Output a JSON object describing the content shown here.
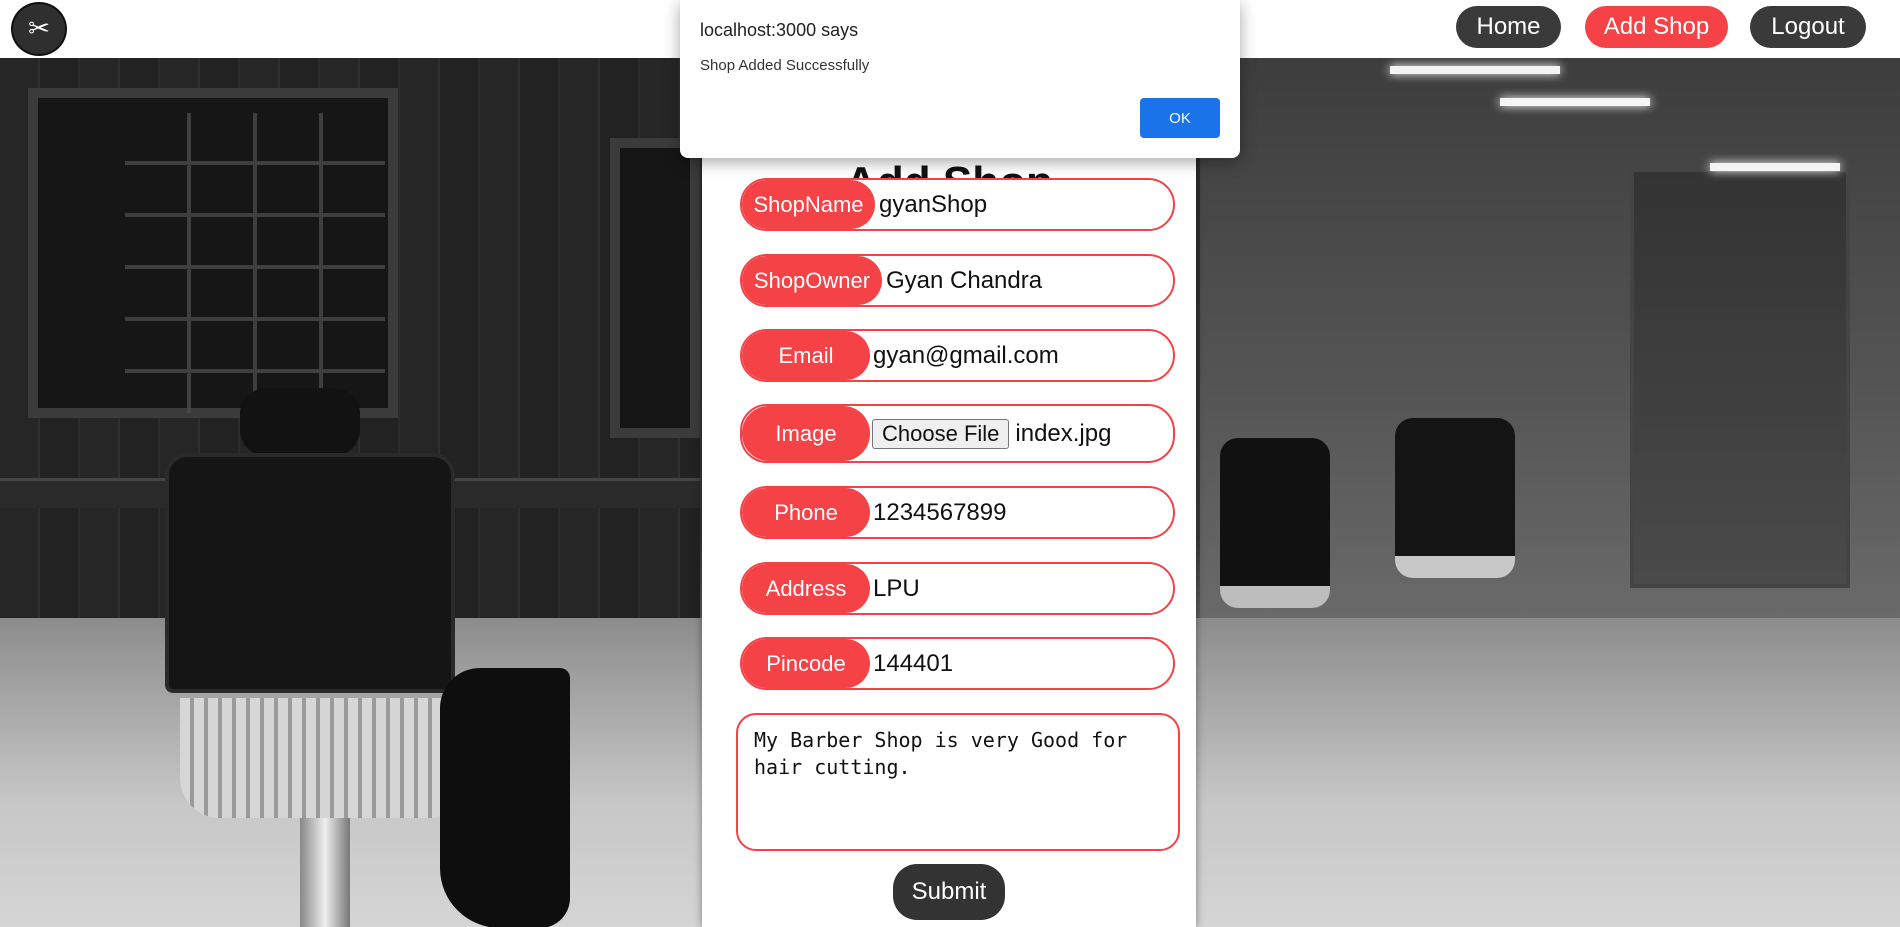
{
  "dialog": {
    "title": "localhost:3000 says",
    "message": "Shop Added Successfully",
    "ok_label": "OK"
  },
  "nav": {
    "logo_icon": "scissors-icon",
    "home_label": "Home",
    "add_shop_label": "Add Shop",
    "logout_label": "Logout"
  },
  "form": {
    "title": "Add Shop",
    "fields": [
      {
        "label": "ShopName",
        "value": "gyanShop"
      },
      {
        "label": "ShopOwner",
        "value": "Gyan Chandra"
      },
      {
        "label": "Email",
        "value": "gyan@gmail.com"
      },
      {
        "label": "Image",
        "button": "Choose File",
        "value": "index.jpg"
      },
      {
        "label": "Phone",
        "value": "1234567899"
      },
      {
        "label": "Address",
        "value": "LPU"
      },
      {
        "label": "Pincode",
        "value": "144401"
      }
    ],
    "description": "My Barber Shop is very Good for hair cutting.",
    "submit_label": "Submit"
  },
  "colors": {
    "accent": "#f44246",
    "dark_button": "#3a3a3a",
    "dialog_button": "#1a73e8"
  }
}
